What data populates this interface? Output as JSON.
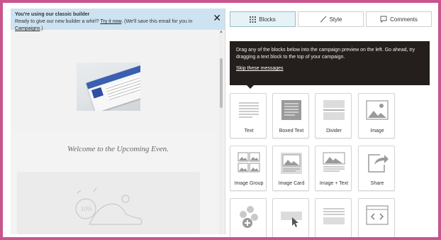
{
  "banner": {
    "title": "You're using our classic builder",
    "text_before": "Ready to give our new builder a whirl?",
    "try_link": "Try it now",
    "text_middle": ". (We'll save this email for you in",
    "campaigns_link": "Campaigns",
    "text_after": ".)",
    "close": "✕"
  },
  "preview": {
    "welcome": "Welcome to the Upcoming Even."
  },
  "tabs": [
    {
      "label": "Blocks",
      "icon": "grid-icon",
      "active": true
    },
    {
      "label": "Style",
      "icon": "brush-icon",
      "active": false
    },
    {
      "label": "Comments",
      "icon": "comment-icon",
      "active": false
    }
  ],
  "tooltip": {
    "text": "Drag any of the blocks below into the campaign preview on the left. Go ahead, try dragging a text block to the top of your campaign.",
    "skip": "Skip these messages"
  },
  "blocks": [
    {
      "label": "Text",
      "icon": "text-icon"
    },
    {
      "label": "Boxed Text",
      "icon": "boxed-text-icon"
    },
    {
      "label": "Divider",
      "icon": "divider-icon"
    },
    {
      "label": "Image",
      "icon": "image-icon"
    },
    {
      "label": "Image Group",
      "icon": "image-group-icon"
    },
    {
      "label": "Image Card",
      "icon": "image-card-icon"
    },
    {
      "label": "Image + Text",
      "icon": "image-text-icon"
    },
    {
      "label": "Share",
      "icon": "share-icon"
    },
    {
      "label": "",
      "icon": "social-follow-icon"
    },
    {
      "label": "",
      "icon": "button-icon"
    },
    {
      "label": "",
      "icon": "footer-icon"
    },
    {
      "label": "",
      "icon": "code-icon"
    }
  ],
  "colors": {
    "frame": "#c8558e",
    "banner_bg": "#cde3f1",
    "tooltip_bg": "#241f1c",
    "active_tab_bg": "#e5f3f6"
  }
}
